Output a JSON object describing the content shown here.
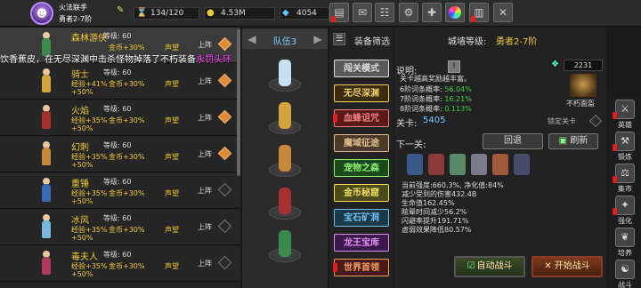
{
  "player": {
    "name": "火法联手",
    "title": "勇者2-7阶"
  },
  "stats": {
    "hp": "134/120",
    "gold": "4.53M",
    "gems": "4054"
  },
  "top_icons": [
    "shop-icon",
    "mail-icon",
    "gamepad-icon",
    "gear-icon",
    "gift-icon",
    "color-wheel-icon",
    "scroll-icon",
    "swords-icon"
  ],
  "ticker": {
    "text": "饮香蕉皮，在无尽深渊中击杀怪物掉落了不朽装备",
    "highlight": "永罚头环"
  },
  "heroes": [
    {
      "name": "森林游侠",
      "level": "等级: 60",
      "exp": "",
      "gold": "金币+30%",
      "fame": "声望",
      "exp2": "",
      "deploy": "上阵",
      "on": true,
      "color": "#3a8a4a"
    },
    {
      "name": "骑士",
      "level": "等级: 60",
      "exp": "经验+41%",
      "gold": "金币+30%",
      "fame": "声望",
      "exp2": "+50%",
      "deploy": "上阵",
      "on": true,
      "color": "#d6a23a"
    },
    {
      "name": "火焰",
      "level": "等级: 60",
      "exp": "经验+35%",
      "gold": "金币+30%",
      "fame": "声望",
      "exp2": "+50%",
      "deploy": "上阵",
      "on": true,
      "color": "#a83030"
    },
    {
      "name": "幻刺",
      "level": "等级: 60",
      "exp": "经验+35%",
      "gold": "金币+30%",
      "fame": "声望",
      "exp2": "+50%",
      "deploy": "上阵",
      "on": true,
      "color": "#c88a3a"
    },
    {
      "name": "重锤",
      "level": "等级: 60",
      "exp": "经验+35%",
      "gold": "金币+30%",
      "fame": "声望",
      "exp2": "+50%",
      "deploy": "上阵",
      "on": false,
      "color": "#3a6ab8"
    },
    {
      "name": "冰风",
      "level": "等级: 60",
      "exp": "经验+35%",
      "gold": "金币+30%",
      "fame": "声望",
      "exp2": "+50%",
      "deploy": "上阵",
      "on": false,
      "color": "#7ab8e0"
    },
    {
      "name": "毒夫人",
      "level": "等级: 60",
      "exp": "经验+35%",
      "gold": "金币+30%",
      "fame": "声望",
      "exp2": "+50%",
      "deploy": "上阵",
      "on": false,
      "color": "#b03a5a"
    }
  ],
  "team": {
    "label": "队伍3",
    "prev": "◀",
    "next": "▶"
  },
  "team_figures": [
    "#c8e0f0",
    "#d6a23a",
    "#c88a3a",
    "#a83030",
    "#3a8a4a"
  ],
  "filter": {
    "label": "装备筛选",
    "icon": "☰"
  },
  "modes": [
    {
      "label": "闯关模式",
      "bg": "#5a5a5a",
      "fg": "#ddd",
      "dot": false
    },
    {
      "label": "无尽深渊",
      "bg": "#3a2a10",
      "fg": "#f0d060",
      "dot": false
    },
    {
      "label": "血蜂诅咒",
      "bg": "#5a1a1a",
      "fg": "#f08080",
      "dot": true
    },
    {
      "label": "魔域征途",
      "bg": "#4a3a2a",
      "fg": "#e0c090",
      "dot": false
    },
    {
      "label": "宠物之森",
      "bg": "#1a4a1a",
      "fg": "#90f070",
      "dot": false
    },
    {
      "label": "金币秘窟",
      "bg": "#4a4a1a",
      "fg": "#f0e060",
      "dot": false
    },
    {
      "label": "宝石矿洞",
      "bg": "#1a3a4a",
      "fg": "#70c0f0",
      "dot": false
    },
    {
      "label": "龙王宝库",
      "bg": "#3a1a4a",
      "fg": "#e090f0",
      "dot": false
    },
    {
      "label": "世界首领",
      "bg": "#4a1a1a",
      "fg": "#f0a060",
      "dot": true
    }
  ],
  "detail": {
    "level_label": "城墙等级:",
    "level_value": "勇者2-7阶",
    "desc_label": "说明:",
    "desc_icon": "!",
    "frag_count": "2231",
    "desc_text": "关卡越高奖励越丰富。",
    "drops": [
      {
        "label": "6阶词条概率: ",
        "value": "56.04%"
      },
      {
        "label": "7阶词条概率: ",
        "value": "16.21%"
      },
      {
        "label": "8阶词条概率: ",
        "value": "0.113%"
      }
    ],
    "boss_label": "不朽面盔",
    "stage_label": "关卡:",
    "stage_value": "5405",
    "lock_label": "锁定关卡",
    "next_label": "下一关:",
    "back_button": "回退",
    "refresh_button": "刷新",
    "stats": [
      "当前强度:660.3%, 净化值:84%",
      "减少受到的伤害432.4B",
      "生命值162.45%",
      "眩晕时间减少56.2%",
      "闪避率提升191.71%",
      "虚弱效果降低80.57%"
    ],
    "auto_battle": "自动战斗",
    "start_battle": "开始战斗"
  },
  "side_nav": [
    {
      "label": "英雄",
      "icon": "⚔",
      "alert": true
    },
    {
      "label": "锻炼",
      "icon": "⚒",
      "alert": true
    },
    {
      "label": "集市",
      "icon": "⚖",
      "alert": true
    },
    {
      "label": "强化",
      "icon": "✦",
      "alert": true
    },
    {
      "label": "培养",
      "icon": "❦",
      "alert": false
    },
    {
      "label": "战斗",
      "icon": "☯",
      "alert": false
    }
  ],
  "colors": {
    "gold": "#eecb34",
    "green": "#3fd04a",
    "blue": "#7dc8ff"
  }
}
